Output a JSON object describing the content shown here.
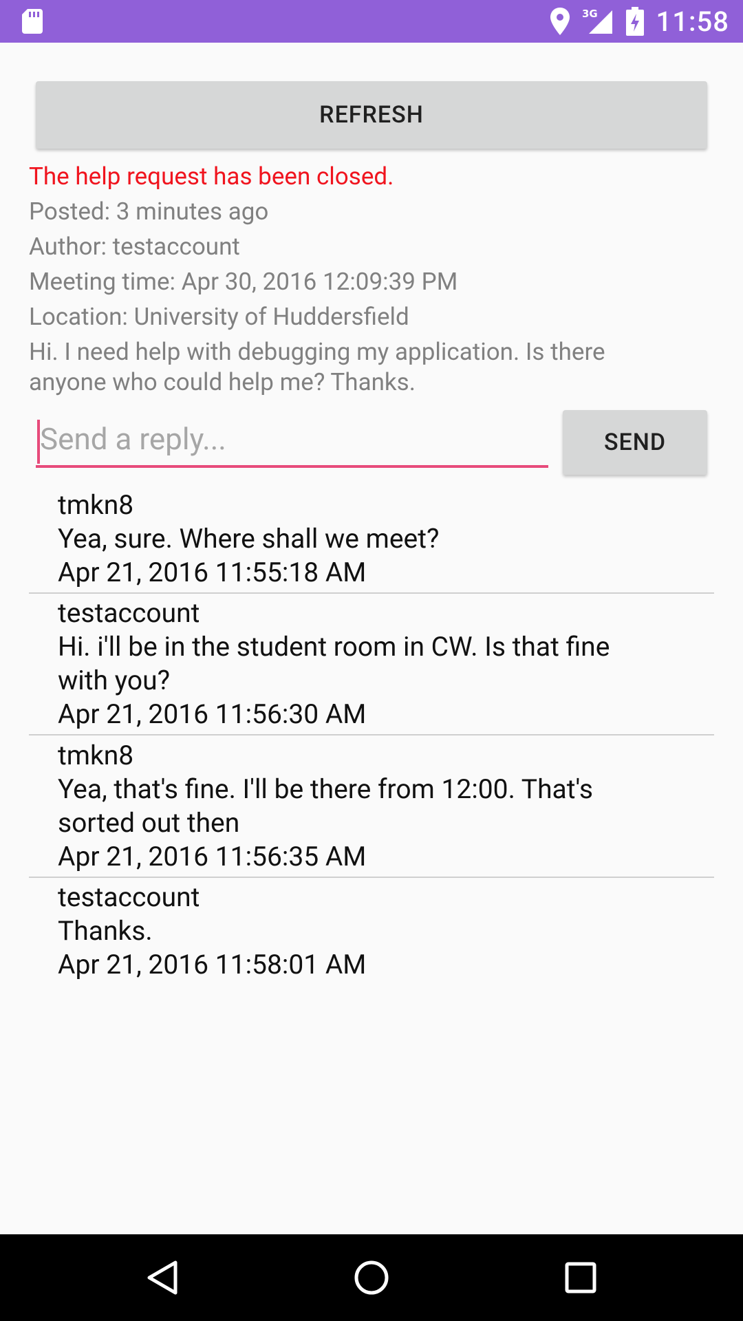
{
  "status_bar": {
    "time": "11:58",
    "network": "3G",
    "icons": [
      "sd-card-icon",
      "location-icon",
      "signal-icon",
      "battery-charging-icon"
    ]
  },
  "toolbar": {
    "refresh_label": "REFRESH"
  },
  "request": {
    "status": "The help request has been closed.",
    "posted": "Posted: 3 minutes ago",
    "author": "Author: testaccount",
    "meeting_time": "Meeting time: Apr 30, 2016 12:09:39 PM",
    "location": "Location: University of Huddersfield",
    "description_line1": "Hi. I need help with debugging my application. Is there",
    "description_line2": "anyone who could help me? Thanks."
  },
  "reply": {
    "placeholder": "Send a reply...",
    "send_label": "SEND"
  },
  "messages": [
    {
      "author": "tmkn8",
      "lines": [
        "Yea, sure. Where shall we meet?"
      ],
      "time": "Apr 21, 2016 11:55:18 AM"
    },
    {
      "author": "testaccount",
      "lines": [
        "Hi. i'll be in the student room in CW.  Is that fine",
        "with you?"
      ],
      "time": "Apr 21, 2016 11:56:30 AM"
    },
    {
      "author": "tmkn8",
      "lines": [
        "Yea, that's fine. I'll be there from 12:00. That's",
        "sorted out then"
      ],
      "time": "Apr 21, 2016 11:56:35 AM"
    },
    {
      "author": "testaccount",
      "lines": [
        "Thanks."
      ],
      "time": "Apr 21, 2016 11:58:01 AM"
    }
  ],
  "nav": {
    "icons": [
      "back-icon",
      "home-icon",
      "recents-icon"
    ]
  },
  "colors": {
    "status_bar": "#9060d8",
    "closed_status": "#f0141e",
    "accent": "#e74b7b",
    "button": "#d6d7d7"
  }
}
